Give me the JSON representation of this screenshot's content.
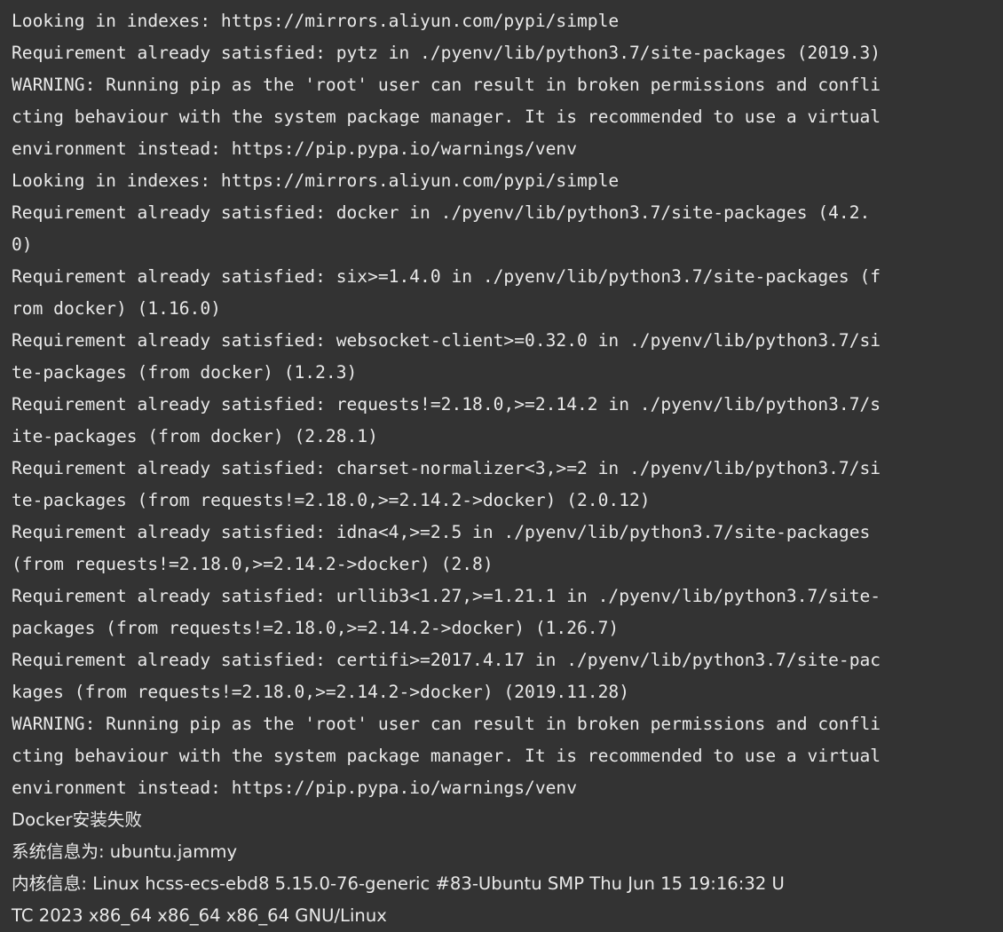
{
  "terminal": {
    "background_color": "#333333",
    "foreground_color": "#e9e9e9",
    "font_size_px": 19.6,
    "line_height_px": 36,
    "columns": 76,
    "lines": [
      "Looking in indexes: https://mirrors.aliyun.com/pypi/simple",
      "Requirement already satisfied: pytz in ./pyenv/lib/python3.7/site-packages (2019.3)",
      "WARNING: Running pip as the 'root' user can result in broken permissions and confli",
      "cting behaviour with the system package manager. It is recommended to use a virtual",
      "environment instead: https://pip.pypa.io/warnings/venv",
      "Looking in indexes: https://mirrors.aliyun.com/pypi/simple",
      "Requirement already satisfied: docker in ./pyenv/lib/python3.7/site-packages (4.2.",
      "0)",
      "Requirement already satisfied: six>=1.4.0 in ./pyenv/lib/python3.7/site-packages (f",
      "rom docker) (1.16.0)",
      "Requirement already satisfied: websocket-client>=0.32.0 in ./pyenv/lib/python3.7/si",
      "te-packages (from docker) (1.2.3)",
      "Requirement already satisfied: requests!=2.18.0,>=2.14.2 in ./pyenv/lib/python3.7/s",
      "ite-packages (from docker) (2.28.1)",
      "Requirement already satisfied: charset-normalizer<3,>=2 in ./pyenv/lib/python3.7/si",
      "te-packages (from requests!=2.18.0,>=2.14.2->docker) (2.0.12)",
      "Requirement already satisfied: idna<4,>=2.5 in ./pyenv/lib/python3.7/site-packages",
      "(from requests!=2.18.0,>=2.14.2->docker) (2.8)",
      "Requirement already satisfied: urllib3<1.27,>=1.21.1 in ./pyenv/lib/python3.7/site-",
      "packages (from requests!=2.18.0,>=2.14.2->docker) (1.26.7)",
      "Requirement already satisfied: certifi>=2017.4.17 in ./pyenv/lib/python3.7/site-pac",
      "kages (from requests!=2.18.0,>=2.14.2->docker) (2019.11.28)",
      "WARNING: Running pip as the 'root' user can result in broken permissions and confli",
      "cting behaviour with the system package manager. It is recommended to use a virtual",
      "environment instead: https://pip.pypa.io/warnings/venv"
    ],
    "cjk_lines": [
      "Docker安装失败",
      "系统信息为: ubuntu.jammy",
      "内核信息: Linux hcss-ecs-ebd8 5.15.0-76-generic #83-Ubuntu SMP Thu Jun 15 19:16:32 U",
      "TC 2023 x86_64 x86_64 x86_64 GNU/Linux"
    ]
  }
}
